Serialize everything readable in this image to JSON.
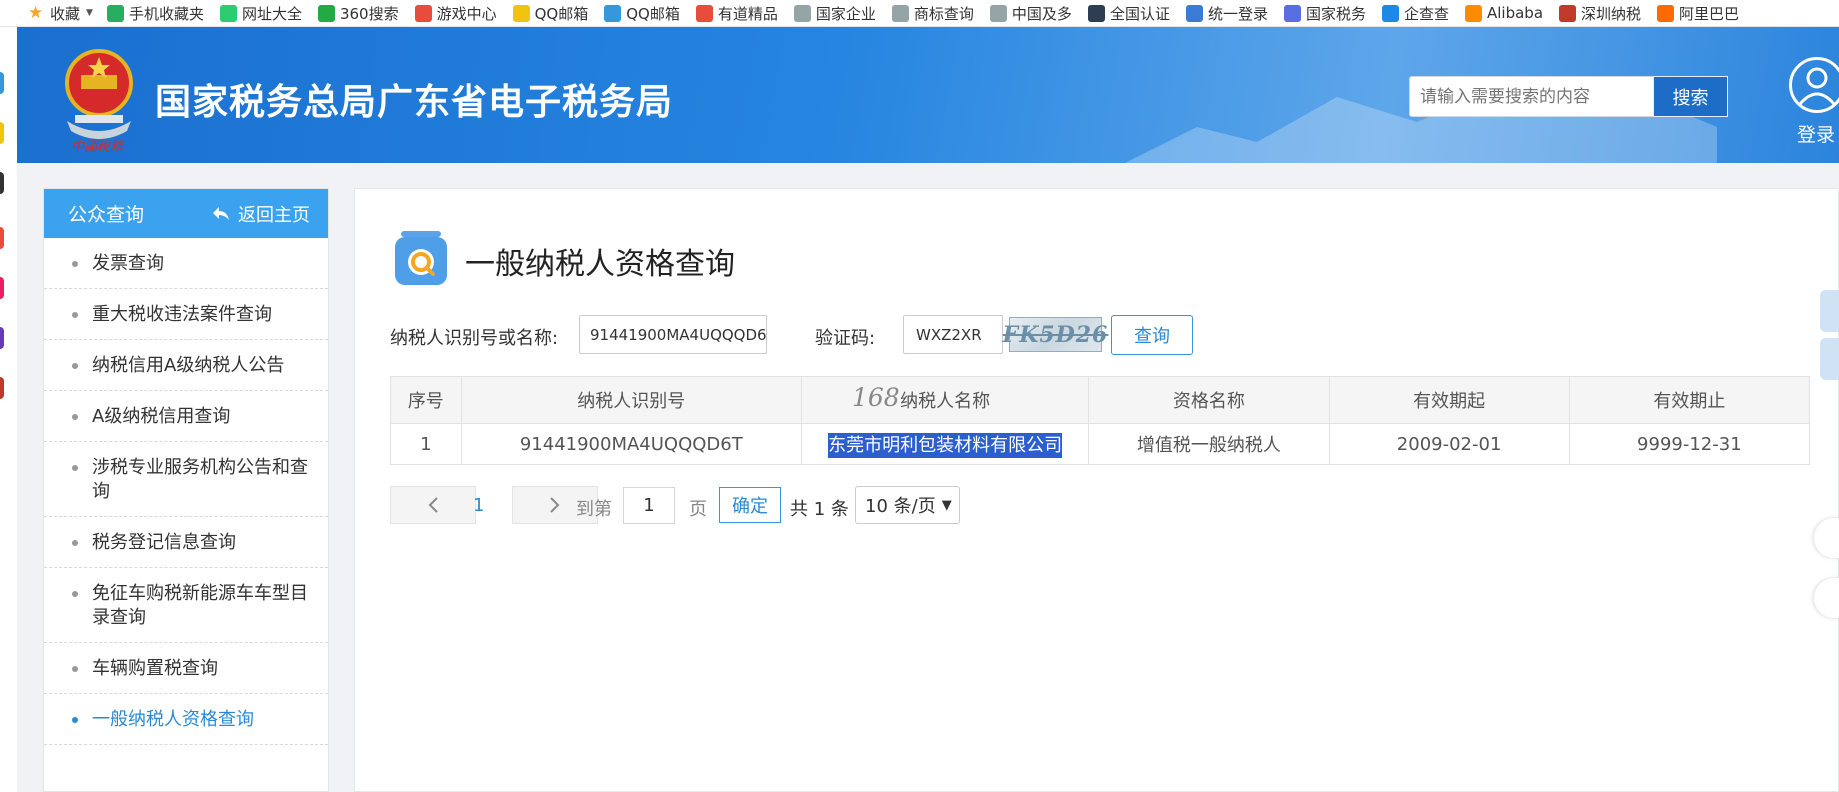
{
  "bookmarks": [
    {
      "label": "收藏",
      "icon": "star-icon",
      "color": "#f5a623"
    },
    {
      "label": "手机收藏夹",
      "icon": "phone-icon",
      "color": "#27ae60"
    },
    {
      "label": "网址大全",
      "icon": "globe-icon",
      "color": "#2ecc71"
    },
    {
      "label": "360搜索",
      "icon": "360-icon",
      "color": "#22aa44"
    },
    {
      "label": "游戏中心",
      "icon": "game-icon",
      "color": "#e74c3c"
    },
    {
      "label": "QQ邮箱",
      "icon": "folder-icon",
      "color": "#f1c40f"
    },
    {
      "label": "QQ邮箱",
      "icon": "qq-mail-icon",
      "color": "#3498db"
    },
    {
      "label": "有道精品",
      "icon": "youdao-icon",
      "color": "#e74c3c"
    },
    {
      "label": "国家企业",
      "icon": "web-icon",
      "color": "#95a5a6"
    },
    {
      "label": "商标查询",
      "icon": "web-icon",
      "color": "#95a5a6"
    },
    {
      "label": "中国及多",
      "icon": "web-icon",
      "color": "#95a5a6"
    },
    {
      "label": "全国认证",
      "icon": "cert-icon",
      "color": "#2c3e50"
    },
    {
      "label": "统一登录",
      "icon": "shield-icon",
      "color": "#3a7bd5"
    },
    {
      "label": "国家税务",
      "icon": "tax-icon",
      "color": "#5b6ee1"
    },
    {
      "label": "企查查",
      "icon": "qcc-icon",
      "color": "#1e88e5"
    },
    {
      "label": "Alibaba",
      "icon": "alibaba-icon",
      "color": "#ff8c00"
    },
    {
      "label": "深圳纳税",
      "icon": "emblem-icon",
      "color": "#c0392b"
    },
    {
      "label": "阿里巴巴",
      "icon": "alibaba-icon",
      "color": "#ff6a00"
    }
  ],
  "header": {
    "site_title": "国家税务总局广东省电子税务局",
    "search_placeholder": "请输入需要搜索的内容",
    "search_button": "搜索",
    "login_label": "登录"
  },
  "sidebar": {
    "title": "公众查询",
    "back_label": "返回主页",
    "items": [
      {
        "label": "发票查询",
        "active": false
      },
      {
        "label": "重大税收违法案件查询",
        "active": false
      },
      {
        "label": "纳税信用A级纳税人公告",
        "active": false
      },
      {
        "label": "A级纳税信用查询",
        "active": false
      },
      {
        "label": "涉税专业服务机构公告和查询",
        "active": false
      },
      {
        "label": "税务登记信息查询",
        "active": false
      },
      {
        "label": "免征车购税新能源车车型目录查询",
        "active": false
      },
      {
        "label": "车辆购置税查询",
        "active": false
      },
      {
        "label": "一般纳税人资格查询",
        "active": true
      }
    ]
  },
  "main": {
    "page_title": "一般纳税人资格查询",
    "taxpayer_label": "纳税人识别号或名称:",
    "taxpayer_value": "91441900MA4UQQQD6",
    "captcha_label": "验证码:",
    "captcha_value": "WXZ2XR",
    "captcha_image_text": "FK5D26",
    "query_button": "查询",
    "watermark": "168",
    "table": {
      "headers": [
        "序号",
        "纳税人识别号",
        "纳税人名称",
        "资格名称",
        "有效期起",
        "有效期止"
      ],
      "rows": [
        [
          "1",
          "91441900MA4UQQQD6T",
          "东莞市明利包装材料有限公司",
          "增值税一般纳税人",
          "2009-02-01",
          "9999-12-31"
        ]
      ]
    },
    "pagination": {
      "current_page": "1",
      "goto_label": "到第",
      "goto_value": "1",
      "page_label": "页",
      "confirm": "确定",
      "total": "共 1 条",
      "page_size": "10 条/页"
    }
  }
}
